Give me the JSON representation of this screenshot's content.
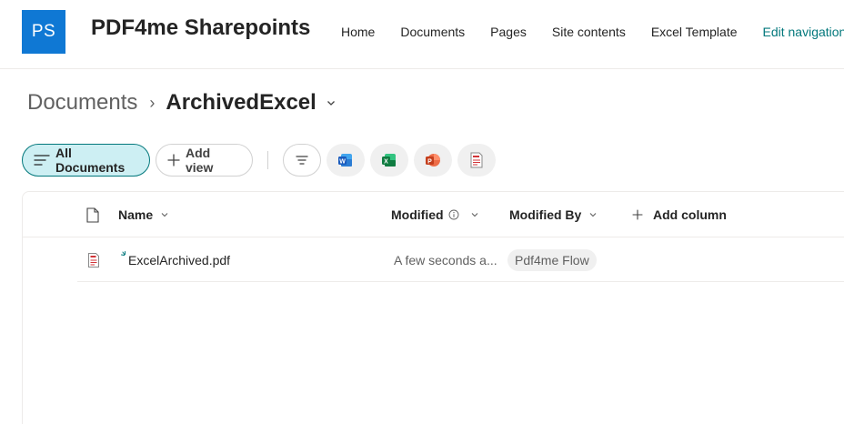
{
  "site": {
    "logo_initials": "PS",
    "title": "PDF4me Sharepoints",
    "nav": [
      {
        "label": "Home"
      },
      {
        "label": "Documents"
      },
      {
        "label": "Pages"
      },
      {
        "label": "Site contents"
      },
      {
        "label": "Excel Template"
      },
      {
        "label": "Edit navigation"
      }
    ]
  },
  "breadcrumb": {
    "root": "Documents",
    "separator": "›",
    "current": "ArchivedExcel"
  },
  "commandbar": {
    "active_view": "All Documents",
    "add_view": "Add view",
    "icons": [
      "filter-icon",
      "word-icon",
      "excel-icon",
      "powerpoint-icon",
      "pdf-icon"
    ]
  },
  "list": {
    "columns": {
      "name": "Name",
      "modified": "Modified",
      "modified_by": "Modified By",
      "add_column": "Add column"
    },
    "rows": [
      {
        "name": "ExcelArchived.pdf",
        "modified": "A few seconds a...",
        "modified_by": "Pdf4me Flow",
        "is_new": true
      }
    ]
  },
  "colors": {
    "accent": "#03787c",
    "logo_bg": "#0f78d4",
    "active_pill_bg": "#cdeff3"
  }
}
